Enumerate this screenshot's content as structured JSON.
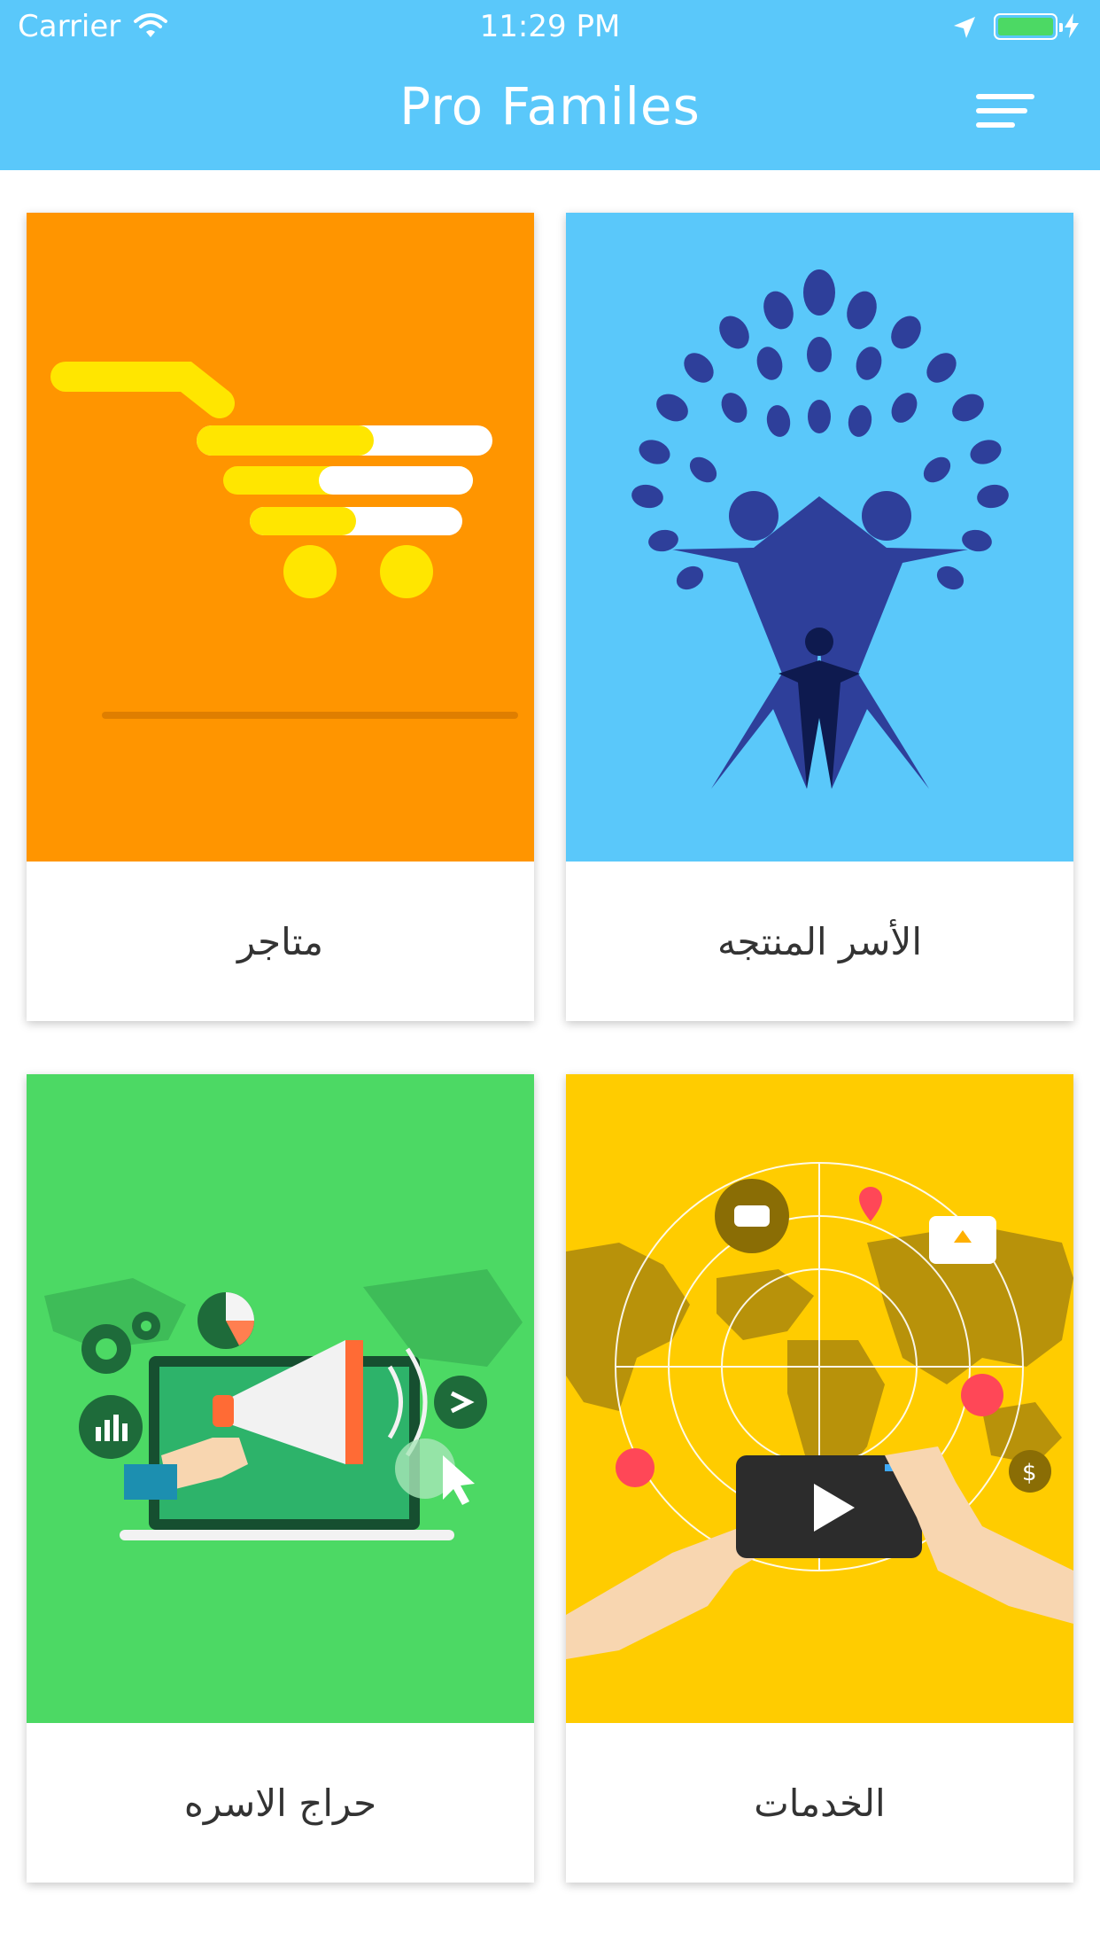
{
  "status_bar": {
    "carrier": "Carrier",
    "time": "11:29 PM"
  },
  "app_bar": {
    "title": "Pro Familes",
    "menu_icon": "menu-icon",
    "color": "#5ac8fa"
  },
  "cards": [
    {
      "label": "الأسر المنتجه",
      "icon": "family-tree-icon",
      "color": "#5ac8fa"
    },
    {
      "label": "متاجر",
      "icon": "shopping-cart-icon",
      "color": "#ff9500"
    },
    {
      "label": "الخدمات",
      "icon": "world-services-icon",
      "color": "#ffcc00"
    },
    {
      "label": "حراج الاسره",
      "icon": "marketing-megaphone-icon",
      "color": "#4cd964"
    }
  ]
}
